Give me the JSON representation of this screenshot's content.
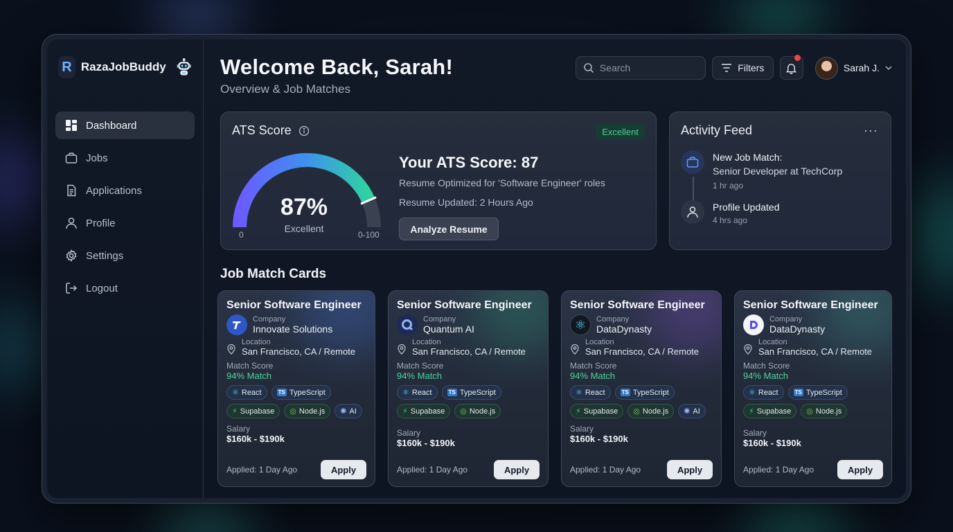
{
  "app": {
    "name": "RazaJobBuddy",
    "logo_letter": "R"
  },
  "nav": [
    {
      "label": "Dashboard",
      "icon": "dashboard-icon",
      "active": true
    },
    {
      "label": "Jobs",
      "icon": "briefcase-icon"
    },
    {
      "label": "Applications",
      "icon": "document-icon"
    },
    {
      "label": "Profile",
      "icon": "user-icon"
    },
    {
      "label": "Settings",
      "icon": "gear-icon"
    },
    {
      "label": "Logout",
      "icon": "logout-icon"
    }
  ],
  "header": {
    "title": "Welcome Back, Sarah!",
    "subtitle": "Overview & Job Matches",
    "search_placeholder": "Search",
    "filters_label": "Filters",
    "user_name": "Sarah J."
  },
  "ats": {
    "title": "ATS Score",
    "badge": "Excellent",
    "percent_label": "87%",
    "score": 87,
    "gauge_label": "Excellent",
    "gauge_min": "0",
    "gauge_max": "0-100",
    "heading": "Your ATS Score: 87",
    "description": "Resume Optimized for 'Software Engineer' roles",
    "updated": "Resume Updated: 2 Hours Ago",
    "button": "Analyze Resume"
  },
  "activity": {
    "title": "Activity Feed",
    "more": "···",
    "items": [
      {
        "title": "New Job Match:",
        "sub": "Senior Developer at TechCorp",
        "time": "1 hr ago"
      },
      {
        "title": "Profile Updated",
        "sub": "",
        "time": "4 hrs ago"
      }
    ]
  },
  "jobs_section": {
    "title": "Job Match Cards"
  },
  "labels": {
    "company": "Company",
    "location": "Location",
    "match": "Match Score",
    "salary": "Salary",
    "apply": "Apply"
  },
  "jobs": [
    {
      "title": "Senior Software Engineer",
      "company": "Innovate Solutions",
      "location": "San Francisco, CA / Remote",
      "match": "94% Match",
      "tags": [
        "React",
        "TypeScript",
        "Supabase",
        "Node.js",
        "AI"
      ],
      "salary": "$160k - $190k",
      "applied": "Applied: 1 Day Ago"
    },
    {
      "title": "Senior Software Engineer",
      "company": "Quantum AI",
      "location": "San Francisco, CA / Remote",
      "match": "94% Match",
      "tags": [
        "React",
        "TypeScript",
        "Supabase",
        "Node.js"
      ],
      "salary": "$160k - $190k",
      "applied": "Applied: 1 Day Ago"
    },
    {
      "title": "Senior Software Engineer",
      "company": "DataDynasty",
      "location": "San Francisco, CA / Remote",
      "match": "94% Match",
      "tags": [
        "React",
        "TypeScript",
        "Supabase",
        "Node.js",
        "AI"
      ],
      "salary": "$160k - $190k",
      "applied": "Applied: 1 Day Ago"
    },
    {
      "title": "Senior Software Engineer",
      "company": "DataDynasty",
      "location": "San Francisco, CA / Remote",
      "match": "94% Match",
      "tags": [
        "React",
        "TypeScript",
        "Supabase",
        "Node.js"
      ],
      "salary": "$160k - $190k",
      "applied": "Applied: 1 Day Ago"
    }
  ],
  "colors": {
    "accent_green": "#4cd69b",
    "gauge_start": "#6a5cff",
    "gauge_end": "#2ed3a1",
    "notification": "#ef4444"
  }
}
